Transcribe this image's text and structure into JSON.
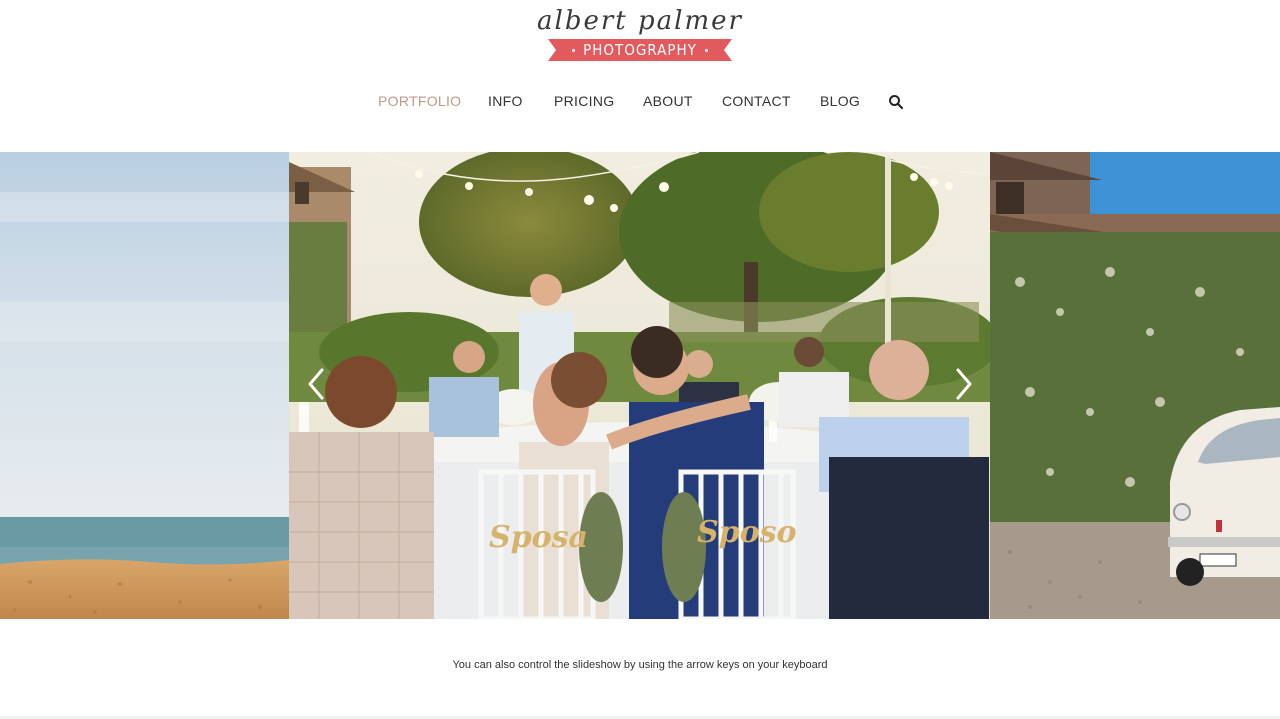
{
  "logo": {
    "script": "albert palmer",
    "ribbon": "PHOTOGRAPHY"
  },
  "nav": {
    "items": [
      {
        "label": "PORTFOLIO",
        "active": true
      },
      {
        "label": "INFO",
        "active": false
      },
      {
        "label": "PRICING",
        "active": false
      },
      {
        "label": "ABOUT",
        "active": false
      },
      {
        "label": "CONTACT",
        "active": false
      },
      {
        "label": "BLOG",
        "active": false
      }
    ],
    "search_icon": "search-icon"
  },
  "slideshow": {
    "slides": [
      {
        "name": "beach-sea-photo"
      },
      {
        "name": "wedding-dinner-photo",
        "sign_left": "Sposa",
        "sign_right": "Sposo"
      },
      {
        "name": "vintage-car-photo"
      }
    ],
    "prev_icon": "chevron-left-icon",
    "next_icon": "chevron-right-icon"
  },
  "hint": "You can also control the slideshow by using the arrow keys on your keyboard",
  "colors": {
    "accent": "#c19a88",
    "ribbon": "#e35a5e",
    "text": "#333333"
  }
}
